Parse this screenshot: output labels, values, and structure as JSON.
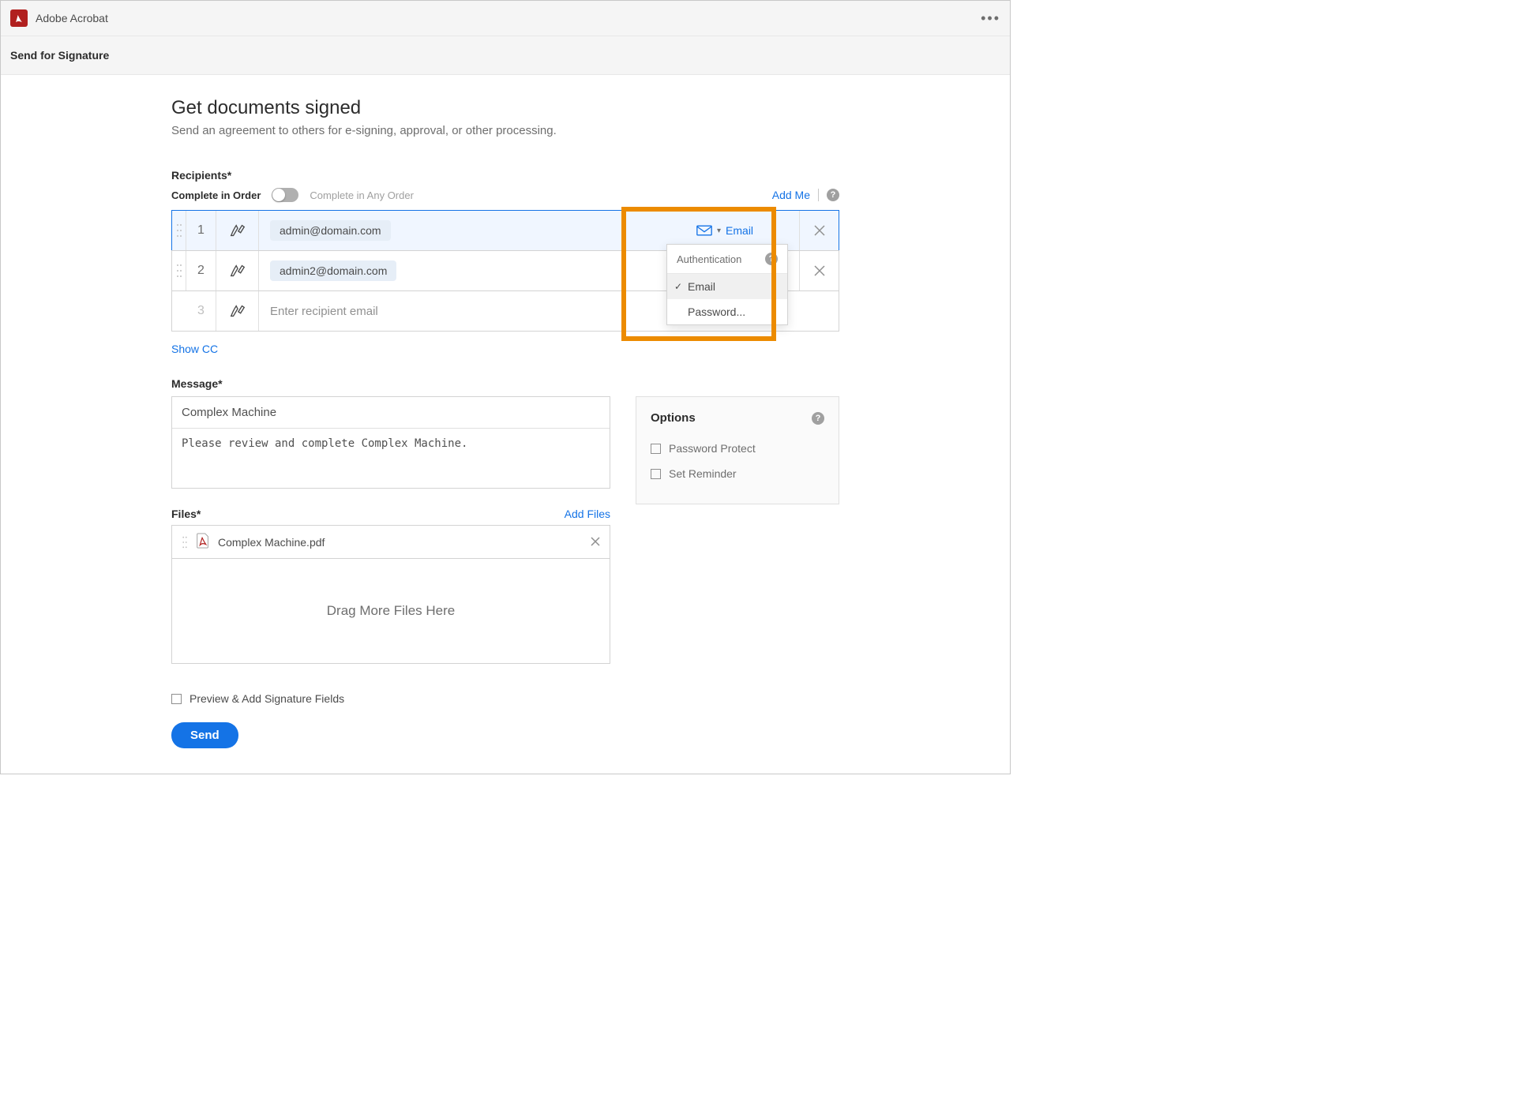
{
  "app": {
    "title": "Adobe Acrobat"
  },
  "subheader": {
    "title": "Send for Signature"
  },
  "page": {
    "title": "Get documents signed",
    "subtitle": "Send an agreement to others for e-signing, approval, or other processing."
  },
  "recipients": {
    "label": "Recipients*",
    "complete_in_order": "Complete in Order",
    "complete_in_any_order": "Complete in Any Order",
    "add_me": "Add Me",
    "show_cc": "Show CC",
    "rows": [
      {
        "num": "1",
        "email": "admin@domain.com",
        "auth": "Email",
        "placeholder": ""
      },
      {
        "num": "2",
        "email": "admin2@domain.com",
        "auth": "",
        "placeholder": ""
      },
      {
        "num": "3",
        "email": "",
        "auth": "",
        "placeholder": "Enter recipient email"
      }
    ],
    "auth_dropdown": {
      "header": "Authentication",
      "items": [
        "Email",
        "Password..."
      ],
      "selected": "Email"
    }
  },
  "message": {
    "label": "Message*",
    "subject": "Complex Machine",
    "body": "Please review and complete Complex Machine."
  },
  "options": {
    "title": "Options",
    "password_protect": "Password Protect",
    "set_reminder": "Set Reminder"
  },
  "files": {
    "label": "Files*",
    "add_files": "Add Files",
    "items": [
      {
        "name": "Complex Machine.pdf"
      }
    ],
    "drop_hint": "Drag More Files Here"
  },
  "preview_label": "Preview & Add Signature Fields",
  "send_label": "Send"
}
